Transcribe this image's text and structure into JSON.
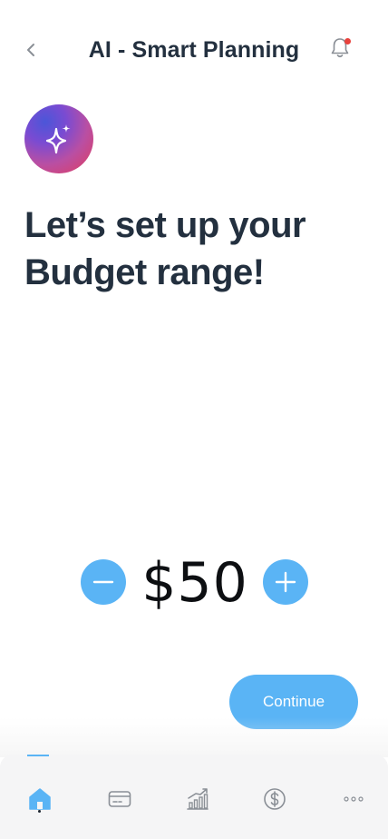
{
  "header": {
    "title": "AI - Smart Planning",
    "back_icon": "chevron-left-icon",
    "bell_icon": "bell-icon",
    "notification_dot_color": "#e8413c"
  },
  "hero": {
    "avatar_icon": "sparkles-icon",
    "headline_line1": "Let’s set up your",
    "headline_line2": "Budget range!"
  },
  "budget": {
    "amount": "$50",
    "decrease_icon": "minus-icon",
    "increase_icon": "plus-icon"
  },
  "actions": {
    "continue_label": "Continue"
  },
  "bottom_nav": {
    "active": "home",
    "items": [
      {
        "id": "home",
        "icon": "home-icon"
      },
      {
        "id": "cards",
        "icon": "credit-card-icon"
      },
      {
        "id": "stats",
        "icon": "chart-icon"
      },
      {
        "id": "money",
        "icon": "dollar-icon"
      },
      {
        "id": "more",
        "icon": "more-icon"
      }
    ]
  },
  "colors": {
    "accent": "#5ab4f5",
    "text_dark": "#23303f",
    "icon_gray": "#8a8f96"
  }
}
